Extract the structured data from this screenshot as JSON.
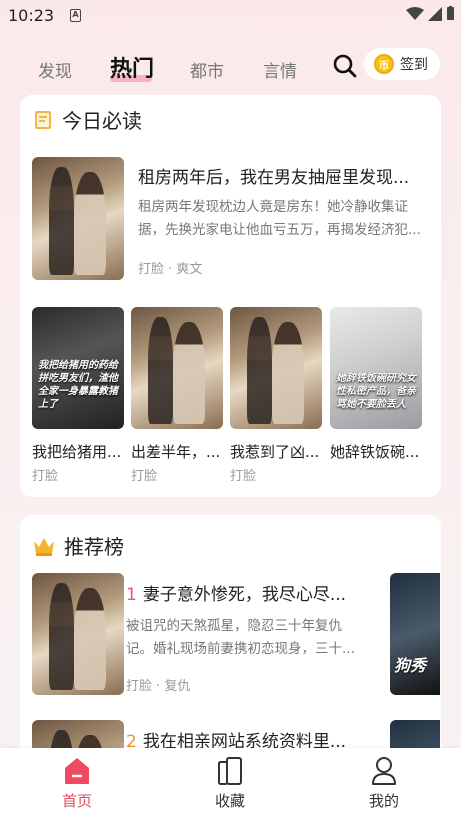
{
  "status_bar": {
    "time": "10:23",
    "notification_icon": "a-box-icon"
  },
  "top_nav": {
    "tabs": [
      {
        "label": "发现",
        "active": false
      },
      {
        "label": "热门",
        "active": true
      },
      {
        "label": "都市",
        "active": false
      },
      {
        "label": "言情",
        "active": false
      }
    ],
    "signin_label": "签到",
    "coin_symbol": "币"
  },
  "daily_read": {
    "header": "今日必读",
    "featured": {
      "title": "租房两年后，我在男友抽屉里发现...",
      "description": "租房两年发现枕边人竟是房东！她冷静收集证据，先换光家电让他血亏五万，再揭发经济犯...",
      "tags": "打脸 · 爽文"
    },
    "grid": [
      {
        "title": "我把给猪用...",
        "tag": "打脸",
        "cover_text": "我把给猪用的药给拼吃男友们，渣他全家一身暴露教猪上了"
      },
      {
        "title": "出差半年，...",
        "tag": "打脸",
        "cover_text": ""
      },
      {
        "title": "我惹到了凶...",
        "tag": "打脸",
        "cover_text": ""
      },
      {
        "title": "她辞铁饭碗...",
        "tag": "",
        "cover_text": "她辞铁饭碗研究女性私密产品，爸亲骂她不要脸丢人"
      }
    ]
  },
  "ranking": {
    "header": "推荐榜",
    "items": [
      {
        "rank": "1",
        "title": "妻子意外惨死，我尽心尽...",
        "description": "被诅咒的天煞孤星，隐忍三十年复仇记。婚礼现场前妻携初恋现身，三十...",
        "tags": "打脸 · 复仇",
        "peek_text": "狗秀"
      },
      {
        "rank": "2",
        "title": "我在相亲网站系统资料里...",
        "description": "",
        "tags": "",
        "peek_text": ""
      }
    ]
  },
  "bottom_nav": [
    {
      "label": "首页",
      "icon": "home-icon",
      "active": true
    },
    {
      "label": "收藏",
      "icon": "bookshelf-icon",
      "active": false
    },
    {
      "label": "我的",
      "icon": "user-icon",
      "active": false
    }
  ],
  "colors": {
    "accent": "#e8475c",
    "rank1": "#e8566b",
    "rank2": "#f0933a",
    "coin": "#f6c21c"
  }
}
